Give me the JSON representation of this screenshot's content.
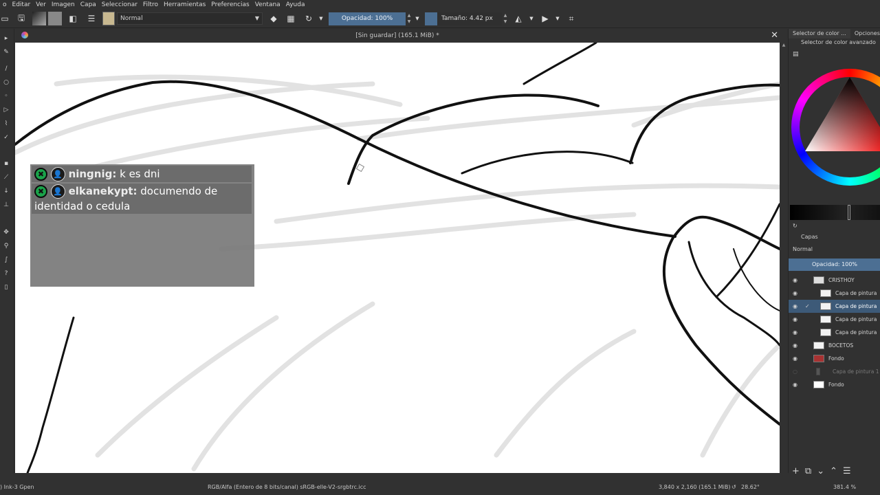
{
  "menu": [
    "o",
    "Editar",
    "Ver",
    "Imagen",
    "Capa",
    "Seleccionar",
    "Filtro",
    "Herramientas",
    "Preferencias",
    "Ventana",
    "Ayuda"
  ],
  "toolbar": {
    "blend_mode": "Normal",
    "opacity_label": "Opacidad: 100%",
    "size_label": "Tamaño: 4.42 px"
  },
  "document": {
    "title": "[Sin guardar]  (165.1 MiB) *",
    "close": "✕"
  },
  "chat": {
    "messages": [
      {
        "user": "ningnig:",
        "text": " k es dni"
      },
      {
        "user": "elkanekypt:",
        "text": " documendo de identidad o cedula"
      }
    ],
    "badge_icon": "✖"
  },
  "docker": {
    "tabs": [
      "Selector de color ...",
      "Opciones"
    ],
    "color_panel_title": "Selector de color avanzado",
    "layers_title": "Capas",
    "layers_blend": "Normal",
    "layers_opacity": "Opacidad:  100%",
    "layers": [
      {
        "name": "CRISTHOY",
        "indent": 0,
        "selected": false,
        "dim": false
      },
      {
        "name": "Capa de pintura",
        "indent": 1,
        "selected": false,
        "dim": false
      },
      {
        "name": "Capa de pintura",
        "indent": 1,
        "selected": true,
        "dim": false
      },
      {
        "name": "Capa de pintura",
        "indent": 1,
        "selected": false,
        "dim": false
      },
      {
        "name": "Capa de pintura",
        "indent": 1,
        "selected": false,
        "dim": false
      },
      {
        "name": "BOCETOS",
        "indent": 0,
        "selected": false,
        "dim": false
      },
      {
        "name": "Fondo",
        "indent": 0,
        "selected": false,
        "dim": false
      },
      {
        "name": "Capa de pintura 1",
        "indent": 0,
        "selected": false,
        "dim": true
      },
      {
        "name": "Fondo",
        "indent": 0,
        "selected": false,
        "dim": false
      }
    ]
  },
  "status": {
    "brush": ") Ink-3 Gpen",
    "color_space": "RGB/Alfa (Entero de 8 bits/canal)  sRGB-elle-V2-srgbtrc.icc",
    "image_size": "3,840 x 2,160 (165.1 MiB)",
    "rotation": "28.62°",
    "zoom": "381.4 %"
  },
  "colors": {
    "accent": "#4c6f93",
    "background": "#313131",
    "canvas": "#ffffff"
  }
}
